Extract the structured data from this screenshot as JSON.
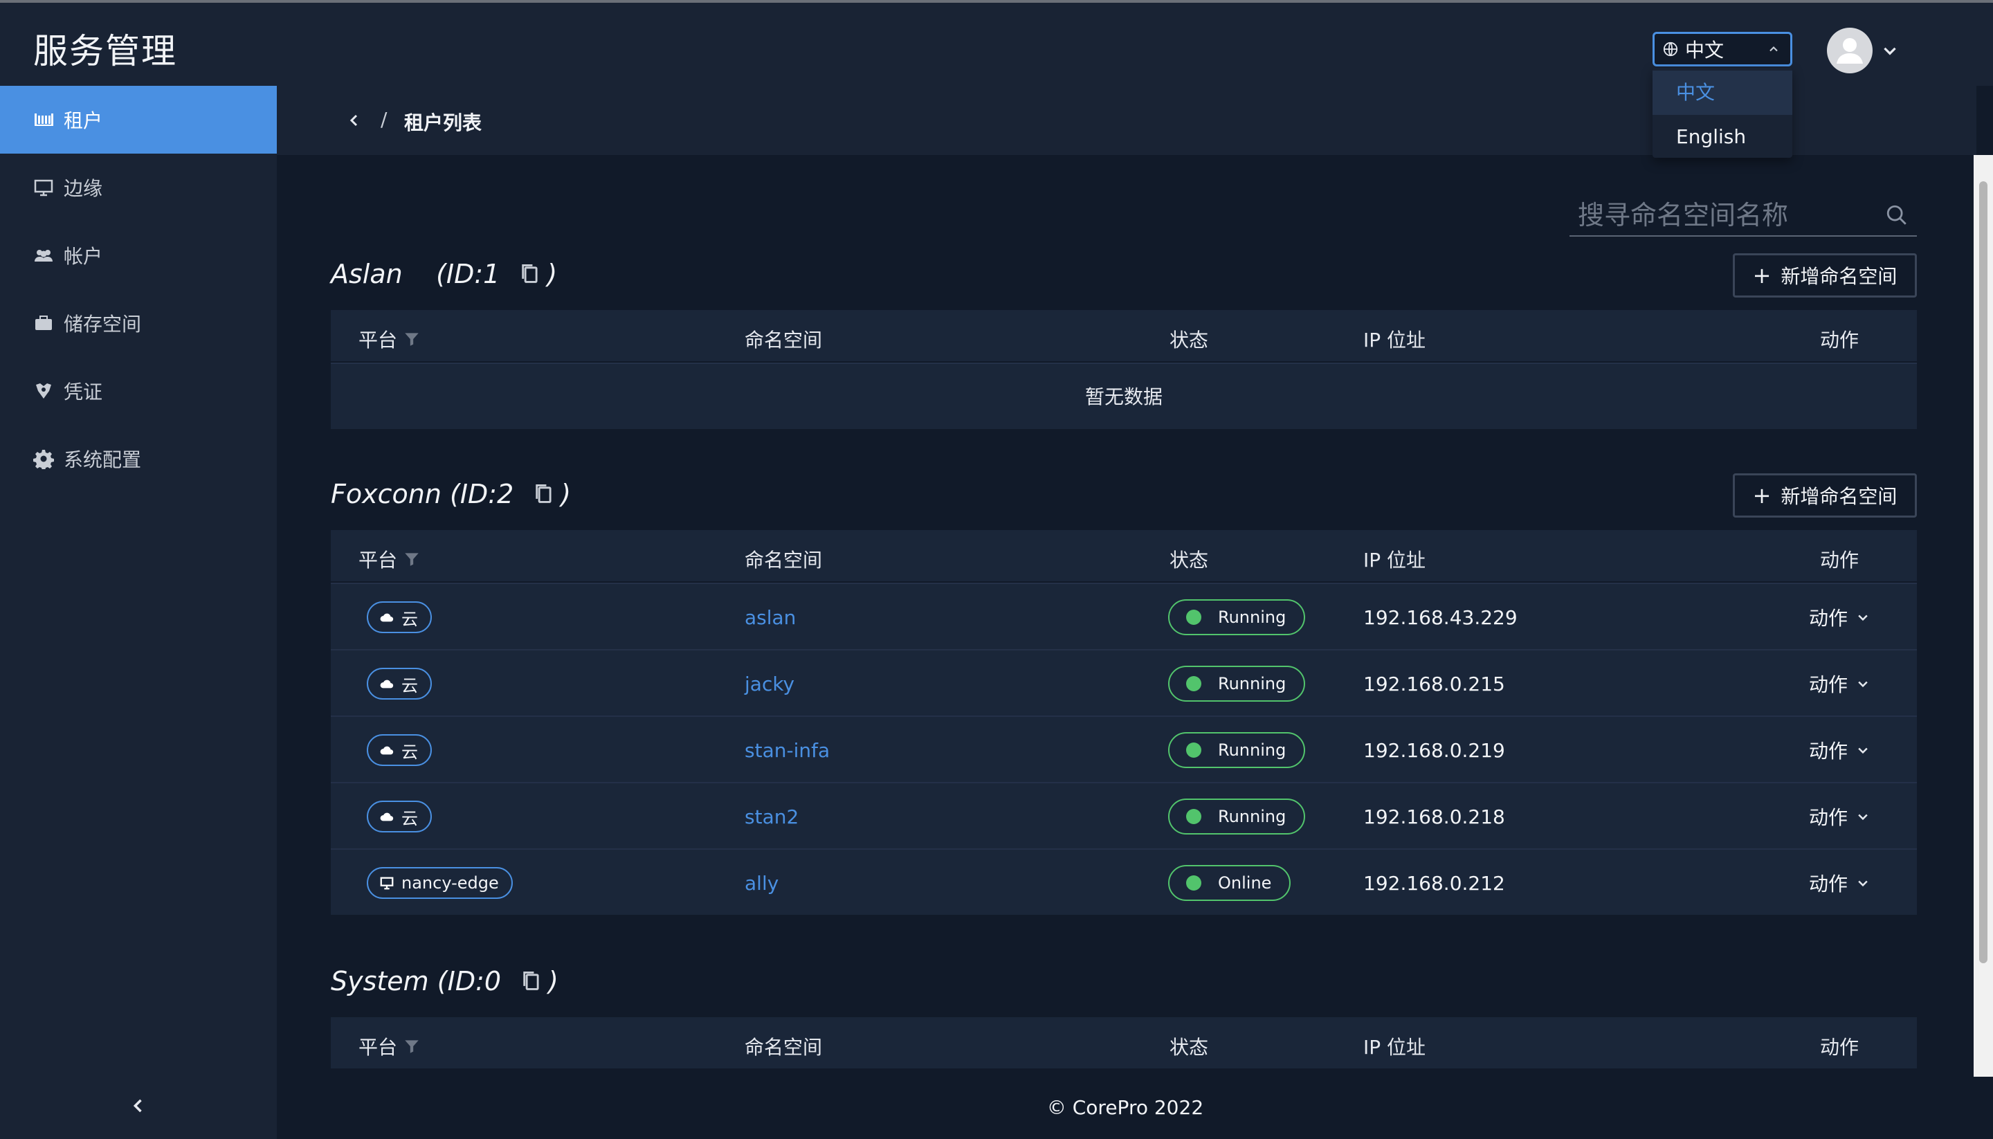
{
  "app": {
    "title": "服务管理"
  },
  "header": {
    "language": {
      "selected": "中文",
      "options": [
        "中文",
        "English"
      ]
    }
  },
  "sidebar": {
    "items": [
      {
        "label": "租户",
        "icon": "tenant-icon",
        "active": true
      },
      {
        "label": "边缘",
        "icon": "monitor-icon"
      },
      {
        "label": "帐户",
        "icon": "users-icon"
      },
      {
        "label": "储存空间",
        "icon": "briefcase-icon"
      },
      {
        "label": "凭证",
        "icon": "credential-icon"
      },
      {
        "label": "系统配置",
        "icon": "gear-icon"
      }
    ]
  },
  "breadcrumb": {
    "separator": "/",
    "current": "租户列表"
  },
  "search": {
    "placeholder": "搜寻命名空间名称"
  },
  "columns": {
    "platform": "平台",
    "namespace": "命名空间",
    "status": "状态",
    "ip": "IP 位址",
    "action": "动作"
  },
  "add_label": "新增命名空间",
  "empty_text": "暂无数据",
  "tenants": [
    {
      "name": "Aslan",
      "id_text": "(ID:1",
      "close": ")"
    },
    {
      "name": "Foxconn",
      "id_text": "(ID:2",
      "close": ")",
      "rows": [
        {
          "platform": "云",
          "platform_icon": "cloud-icon",
          "namespace": "aslan",
          "status": "Running",
          "ip": "192.168.43.229",
          "action": "动作"
        },
        {
          "platform": "云",
          "platform_icon": "cloud-icon",
          "namespace": "jacky",
          "status": "Running",
          "ip": "192.168.0.215",
          "action": "动作"
        },
        {
          "platform": "云",
          "platform_icon": "cloud-icon",
          "namespace": "stan-infa",
          "status": "Running",
          "ip": "192.168.0.219",
          "action": "动作"
        },
        {
          "platform": "云",
          "platform_icon": "cloud-icon",
          "namespace": "stan2",
          "status": "Running",
          "ip": "192.168.0.218",
          "action": "动作"
        },
        {
          "platform": "nancy-edge",
          "platform_icon": "monitor-icon",
          "namespace": "ally",
          "status": "Online",
          "ip": "192.168.0.212",
          "action": "动作"
        }
      ]
    },
    {
      "name": "System",
      "id_text": "(ID:0",
      "close": ")"
    }
  ],
  "footer": {
    "text": "© CorePro 2022"
  },
  "colors": {
    "accent": "#4a90e2",
    "success": "#52c46c",
    "bg": "#111a29",
    "panel": "#192334"
  }
}
